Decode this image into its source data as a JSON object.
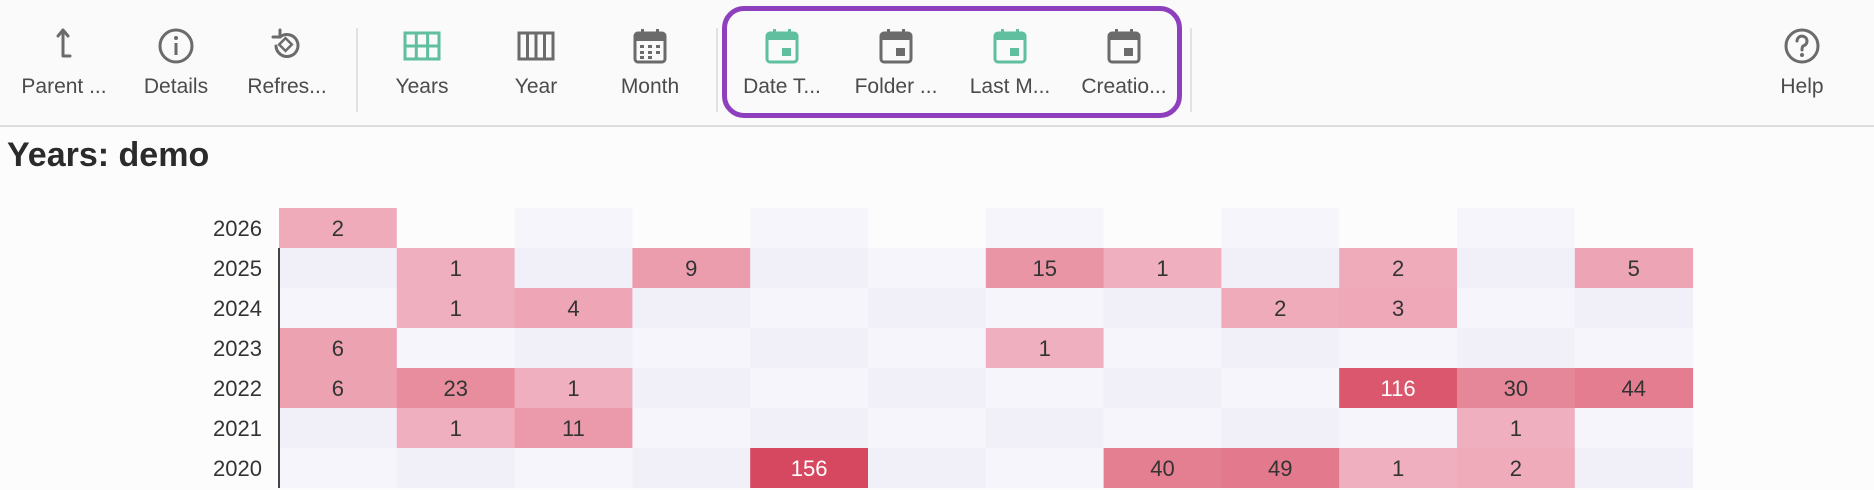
{
  "toolbar": {
    "buttons": [
      {
        "id": "parent",
        "label": "Parent ...",
        "icon": "arrow-up-icon"
      },
      {
        "id": "details",
        "label": "Details",
        "icon": "info-icon"
      },
      {
        "id": "refresh",
        "label": "Refres...",
        "icon": "refresh-icon"
      },
      {
        "id": "years",
        "label": "Years",
        "icon": "grid-icon"
      },
      {
        "id": "year",
        "label": "Year",
        "icon": "columns-icon"
      },
      {
        "id": "month",
        "label": "Month",
        "icon": "calendar-icon"
      },
      {
        "id": "date-taken",
        "label": "Date T...",
        "icon": "calendar-event-icon"
      },
      {
        "id": "folder-date",
        "label": "Folder ...",
        "icon": "calendar-event-icon"
      },
      {
        "id": "last-modified",
        "label": "Last M...",
        "icon": "calendar-event-icon"
      },
      {
        "id": "creation",
        "label": "Creatio...",
        "icon": "calendar-event-icon"
      },
      {
        "id": "help",
        "label": "Help",
        "icon": "help-icon"
      }
    ],
    "colors": {
      "accent": "#5fbf9f",
      "icon": "#6b6b6b",
      "highlight": "#8e3fbe"
    }
  },
  "page": {
    "title": "Years: demo"
  },
  "chart_data": {
    "type": "heatmap",
    "rows": [
      "2026",
      "2025",
      "2024",
      "2023",
      "2022",
      "2021",
      "2020"
    ],
    "columns_count": 12,
    "values": [
      [
        2,
        null,
        null,
        null,
        null,
        null,
        null,
        null,
        null,
        null,
        null,
        null
      ],
      [
        null,
        1,
        null,
        9,
        null,
        null,
        15,
        1,
        null,
        2,
        null,
        5
      ],
      [
        null,
        1,
        4,
        null,
        null,
        null,
        null,
        null,
        2,
        3,
        null,
        null
      ],
      [
        6,
        null,
        null,
        null,
        null,
        null,
        1,
        null,
        null,
        null,
        null,
        null
      ],
      [
        6,
        23,
        1,
        null,
        null,
        null,
        null,
        null,
        null,
        116,
        30,
        44
      ],
      [
        null,
        1,
        11,
        null,
        null,
        null,
        null,
        null,
        null,
        null,
        1,
        null
      ],
      [
        null,
        null,
        null,
        null,
        156,
        null,
        null,
        40,
        49,
        1,
        2,
        null
      ]
    ],
    "colors": {
      "low": "#f2b8c6",
      "high": "#d6485f",
      "empty": "#f5f4fa"
    }
  }
}
